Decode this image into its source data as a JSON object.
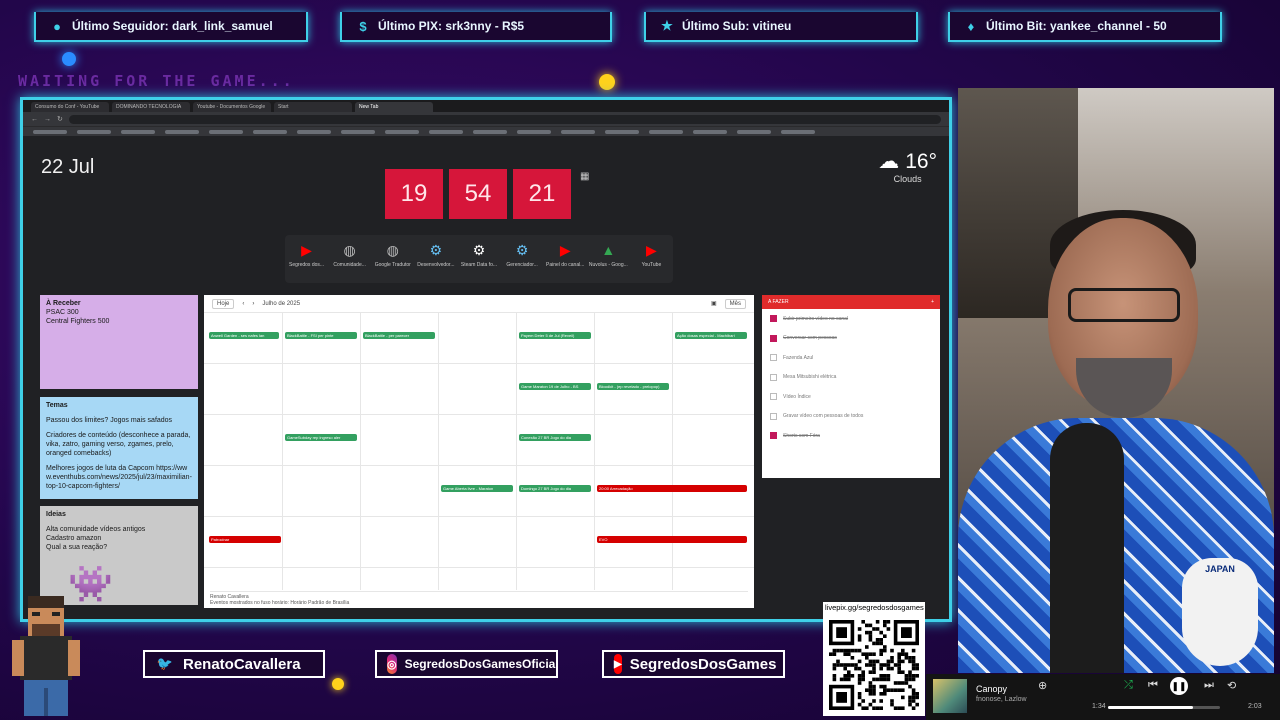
{
  "alerts": {
    "follower": "Último Seguidor: dark_link_samuel",
    "pix": "Último PIX: srk3nny - R$5",
    "sub": "Último Sub: vitineu",
    "bit": "Último Bit: yankee_channel - 50"
  },
  "waiting_text": "WAITING FOR THE GAME...",
  "browser": {
    "tabs": [
      "Consumo do Conf - YouTube",
      "DOMINANDO TECNOLOGIA",
      "Youtube - Documentos Google",
      "Start"
    ],
    "active_tab": "New Tab"
  },
  "newtab": {
    "date": "22 Jul",
    "clock": {
      "hours": "19",
      "minutes": "54",
      "seconds": "21"
    },
    "weather": {
      "temp": "16°",
      "condition": "Clouds"
    },
    "shortcuts": [
      {
        "label": "Segredos dos...",
        "icon": "youtube-icon",
        "color": "#ff0000"
      },
      {
        "label": "Comunidade...",
        "icon": "globe-icon",
        "color": "#bbbbbb"
      },
      {
        "label": "Google Tradutor",
        "icon": "globe-icon",
        "color": "#bbbbbb"
      },
      {
        "label": "Desenvolvedor...",
        "icon": "steam-icon",
        "color": "#66c0f4"
      },
      {
        "label": "Steam Data fo...",
        "icon": "steam-icon",
        "color": "#ffffff"
      },
      {
        "label": "Gerenciador...",
        "icon": "steam-icon",
        "color": "#66c0f4"
      },
      {
        "label": "Painel do canal...",
        "icon": "youtube-icon",
        "color": "#ff0000"
      },
      {
        "label": "Nuvolus - Goog...",
        "icon": "drive-icon",
        "color": "#34a853"
      },
      {
        "label": "YouTube",
        "icon": "youtube-icon",
        "color": "#ff0000"
      }
    ]
  },
  "notes": {
    "receber": {
      "title": "À Receber",
      "lines": [
        "PSAC 300",
        "Central Fighters 500"
      ]
    },
    "temas": {
      "title": "Temas",
      "lines": [
        "Passou dos limites? Jogos mais safados",
        "Criadores de conteúdo (desconhece a parada, vika, zatro, gaming verso, zgames, prelo, oranged comebacks)",
        "Melhores jogos de luta da Capcom https://www.eventhubs.com/news/2025/jul/23/maximilian-top-10-capcom-fighters/"
      ]
    },
    "ideias": {
      "title": "Ideias",
      "lines": [
        "Alta comunidade vídeos antigos",
        "Cadastro amazon",
        "Qual a sua reação?"
      ]
    }
  },
  "calendar": {
    "month": "Julho de 2025",
    "today_label": "Hoje",
    "view_label": "Mês",
    "owner": "Renato Cavallera",
    "events_green": [
      "Anwell Garden - ses nafes lan",
      "BlackBattle - FSI per pinte",
      "BlackBattle - per parecer",
      "Payem Deter 5 de Jul (Reveil)",
      "Ação dosas especial - Machibari",
      "Game Maraton 19 de Julho - BS",
      "Bloodkit - (ep revelado - prelopop)",
      "GameSubday rep ingreso aler",
      "Conexão 27 BR Jogo do dia",
      "Game Aberta livre - Maraton",
      "Domingo 27 BR Jogo do dia"
    ],
    "events_red": [
      "20:00 Arrecadação",
      "Patrocinar",
      "EVO"
    ],
    "footer": "Eventos mostrados no fuso horário: Horário Padrão de Brasília"
  },
  "tasks": {
    "header": "A FAZER",
    "items": [
      {
        "label": "Subir primeiro vídeo no canal",
        "checked": true
      },
      {
        "label": "Conversar com pessoas",
        "checked": true
      },
      {
        "label": "Fazenda Azul",
        "checked": false
      },
      {
        "label": "Mesa Mitsubishi elétrica",
        "checked": false
      },
      {
        "label": "Vídeo Índice",
        "checked": false
      },
      {
        "label": "Gravar vídeo com pessoas de todos",
        "checked": false
      },
      {
        "label": "Shorts com Fóra",
        "checked": true
      }
    ]
  },
  "social": {
    "twitter": "RenatoCavallera",
    "instagram": "SegredosDosGamesOficial",
    "youtube": "SegredosDosGames"
  },
  "qr": {
    "url": "livepix.gg/segredosdosgames"
  },
  "spotify": {
    "song": "Canopy",
    "artist": "fnonose, Lazlow",
    "elapsed": "1:34",
    "duration": "2:03",
    "progress": 0.76
  },
  "webcam": {
    "badge": "JAPAN"
  },
  "colors": {
    "frame": "#3fd0e8",
    "clock": "#d6163a",
    "pink": "#e01b8c",
    "purple": "#22064a"
  }
}
